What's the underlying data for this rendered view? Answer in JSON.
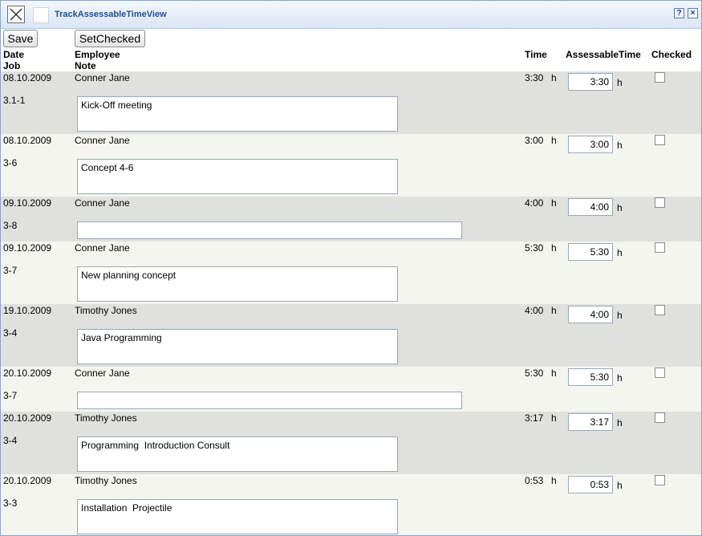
{
  "window": {
    "title": "TrackAssessableTimeView",
    "help_label": "?",
    "close_label": "×"
  },
  "toolbar": {
    "save_label": "Save",
    "setchecked_label": "SetChecked"
  },
  "headers": {
    "date": "Date",
    "job": "Job",
    "employee": "Employee",
    "note": "Note",
    "time": "Time",
    "assessable": "AssessableTime",
    "checked": "Checked"
  },
  "unit": "h",
  "rows": [
    {
      "date": "08.10.2009",
      "job": "3.1-1",
      "employee": "Conner Jane",
      "note": "Kick-Off meeting",
      "time": "3:30",
      "assessable": "3:30",
      "checked": false
    },
    {
      "date": "08.10.2009",
      "job": "3-6",
      "employee": "Conner Jane",
      "note": "Concept 4-6",
      "time": "3:00",
      "assessable": "3:00",
      "checked": false
    },
    {
      "date": "09.10.2009",
      "job": "3-8",
      "employee": "Conner Jane",
      "note": "",
      "time": "4:00",
      "assessable": "4:00",
      "checked": false
    },
    {
      "date": "09.10.2009",
      "job": "3-7",
      "employee": "Conner Jane",
      "note": "New planning concept",
      "time": "5:30",
      "assessable": "5:30",
      "checked": false
    },
    {
      "date": "19.10.2009",
      "job": "3-4",
      "employee": "Timothy Jones",
      "note": "Java Programming",
      "time": "4:00",
      "assessable": "4:00",
      "checked": false
    },
    {
      "date": "20.10.2009",
      "job": "3-7",
      "employee": "Conner Jane",
      "note": "",
      "time": "5:30",
      "assessable": "5:30",
      "checked": false
    },
    {
      "date": "20.10.2009",
      "job": "3-4",
      "employee": "Timothy Jones",
      "note": "Programming  Introduction Consult",
      "time": "3:17",
      "assessable": "3:17",
      "checked": false
    },
    {
      "date": "20.10.2009",
      "job": "3-3",
      "employee": "Timothy Jones",
      "note": "Installation  Projectile",
      "time": "0:53",
      "assessable": "0:53",
      "checked": false
    }
  ]
}
